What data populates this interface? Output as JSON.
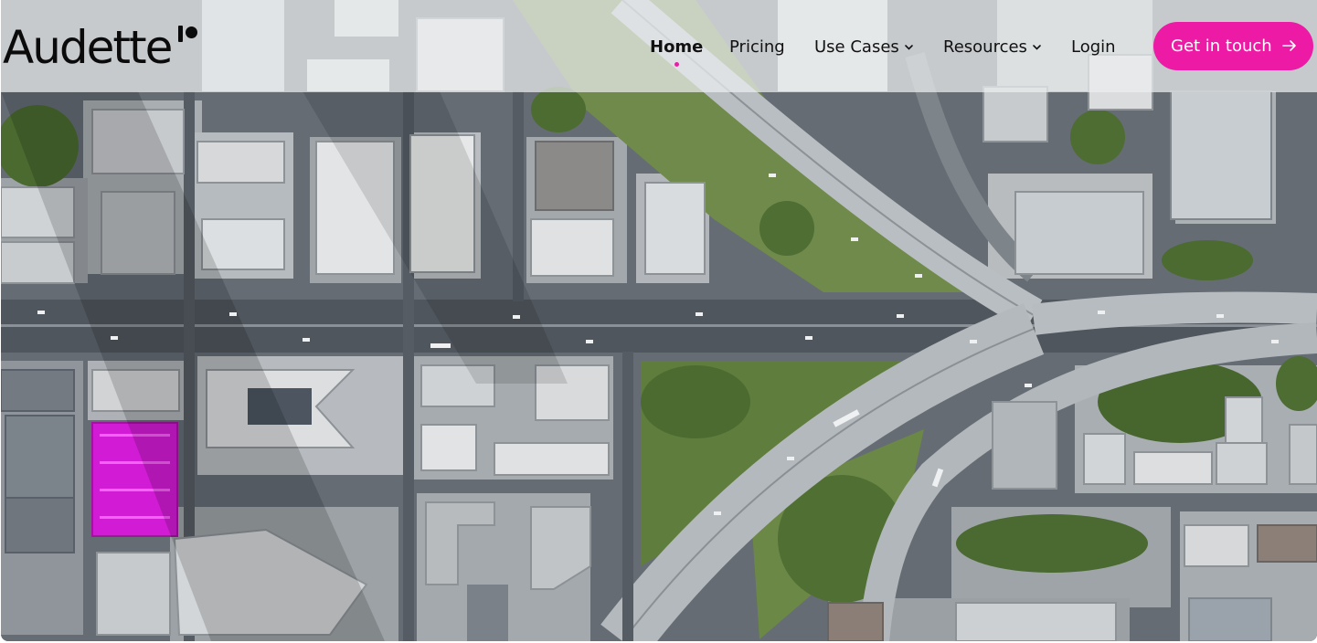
{
  "brand": {
    "name": "Audette",
    "accent_color": "#ec1aa5"
  },
  "nav": {
    "items": [
      {
        "label": "Home",
        "active": true,
        "has_dropdown": false
      },
      {
        "label": "Pricing",
        "active": false,
        "has_dropdown": false
      },
      {
        "label": "Use Cases",
        "active": false,
        "has_dropdown": true,
        "icon": "chevron-down-icon"
      },
      {
        "label": "Resources",
        "active": false,
        "has_dropdown": true,
        "icon": "chevron-down-icon"
      },
      {
        "label": "Login",
        "active": false,
        "has_dropdown": false
      }
    ],
    "cta": {
      "label": "Get in touch",
      "icon": "arrow-right-icon"
    }
  },
  "hero": {
    "image": "aerial-city-intersection",
    "highlight_color": "#d21bd4"
  }
}
